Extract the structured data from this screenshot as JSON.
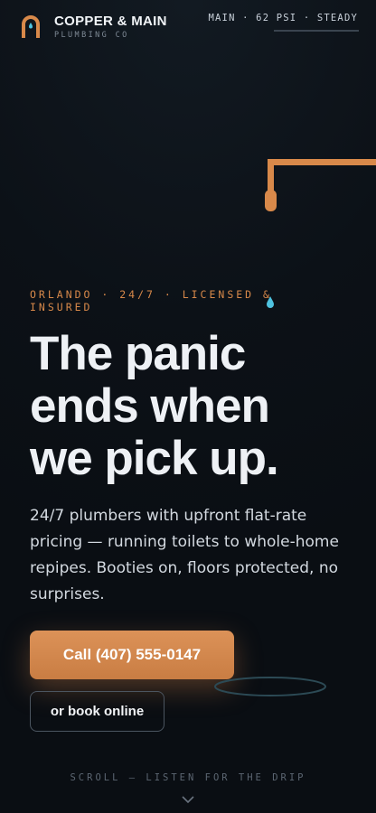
{
  "brand": {
    "name": "COPPER & MAIN",
    "tagline": "PLUMBING CO",
    "logo_icon": "copper-arch-drop-icon"
  },
  "status": {
    "text": "MAIN · 62 PSI · STEADY"
  },
  "hero": {
    "eyebrow": "ORLANDO · 24/7 · LICENSED & INSURED",
    "headline_lines": [
      "The panic",
      "ends when",
      "we pick up."
    ],
    "subcopy": "24/7 plumbers with upfront flat-rate pricing — running toilets to whole-home repipes. Booties on, floors protected, no surprises.",
    "primary_cta": "Call (407) 555-0147",
    "secondary_cta": "or book online"
  },
  "scroll": {
    "hint": "SCROLL — LISTEN FOR THE DRIP",
    "icon": "chevron-down-icon"
  },
  "colors": {
    "background": "#0d1218",
    "copper": "#d8894a",
    "drip": "#4fc3e0",
    "text": "#eef1f5"
  }
}
